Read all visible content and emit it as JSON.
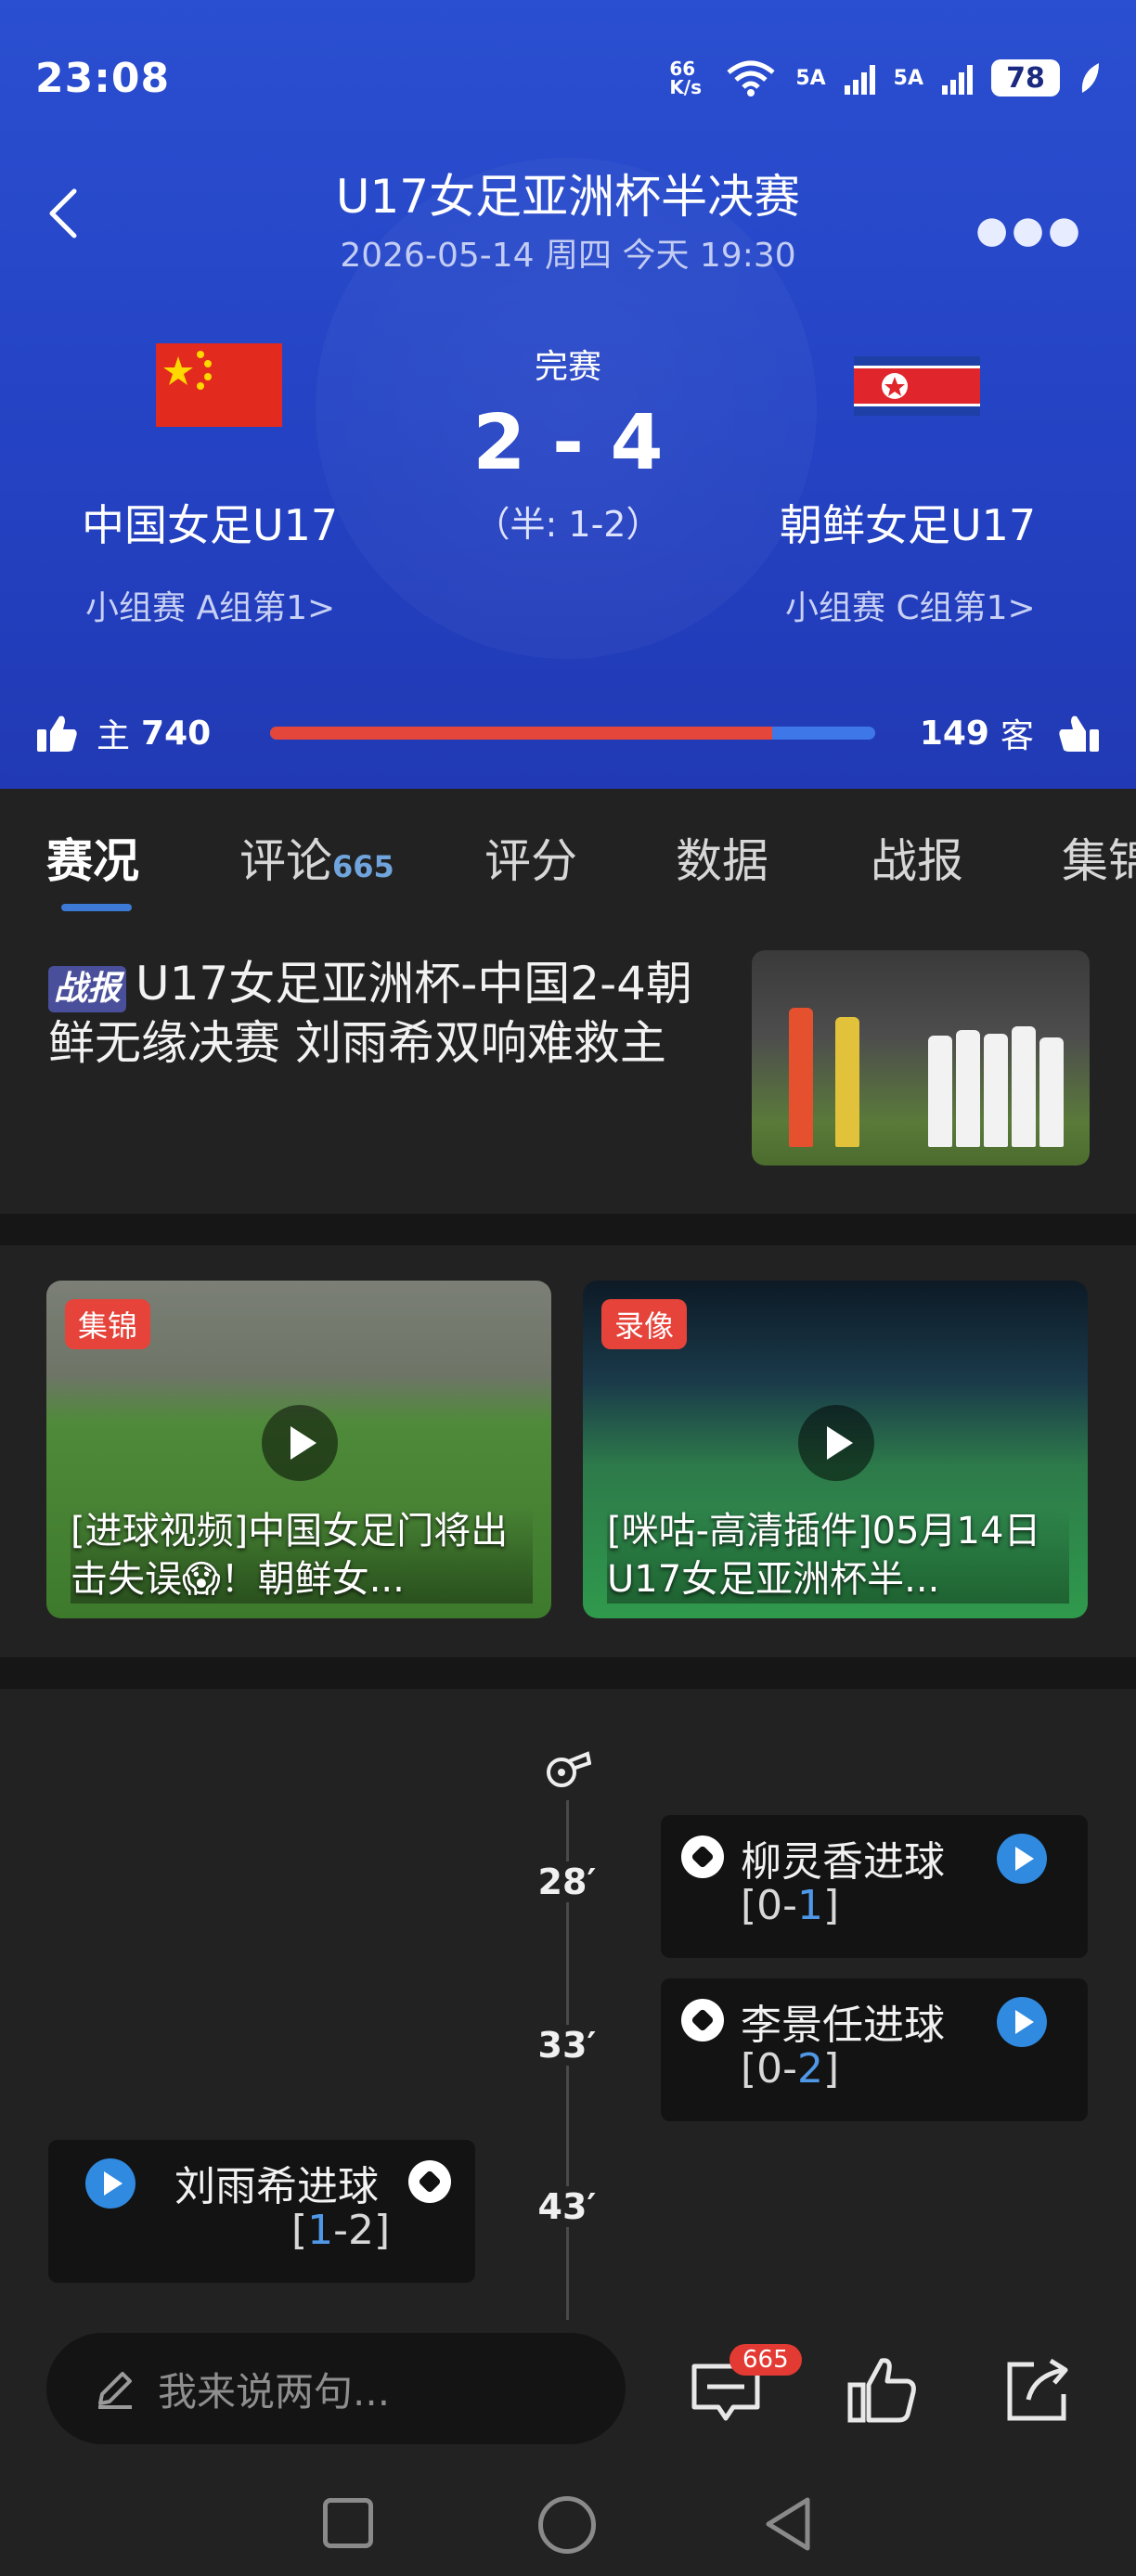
{
  "status_bar": {
    "time": "23:08",
    "net_speed": "66 K/s",
    "signal_1": "5A",
    "signal_2": "5A",
    "battery": "78"
  },
  "match": {
    "title": "U17女足亚洲杯半决赛",
    "datetime": "2026-05-14 周四 今天 19:30",
    "state": "完赛",
    "score": "2 - 4",
    "halftime": "（半: 1-2）",
    "home": {
      "name": "中国女足U17",
      "rank": "小组赛 A组第1>"
    },
    "away": {
      "name": "朝鲜女足U17",
      "rank": "小组赛 C组第1>"
    }
  },
  "votes": {
    "home_label": "主",
    "home_count": "740",
    "away_label": "客",
    "away_count": "149",
    "home_share": 0.83
  },
  "tabs": [
    {
      "label": "赛况"
    },
    {
      "label": "评论",
      "count": "665"
    },
    {
      "label": "评分"
    },
    {
      "label": "数据"
    },
    {
      "label": "战报"
    },
    {
      "label": "集锦"
    }
  ],
  "news": {
    "tag": "战报",
    "headline": "U17女足亚洲杯-中国2-4朝鲜无缘决赛 刘雨希双响难救主"
  },
  "videos": [
    {
      "badge": "集锦",
      "title": "[进球视频]中国女足门将出击失误😱！朝鲜女..."
    },
    {
      "badge": "录像",
      "title": "[咪咕-高清插件]05月14日  U17女足亚洲杯半..."
    }
  ],
  "timeline": [
    {
      "minute": "28′",
      "side": "away",
      "text": "柳灵香进球",
      "score_prefix": "[0-",
      "score_hl": "1",
      "score_suffix": "]"
    },
    {
      "minute": "33′",
      "side": "away",
      "text": "李景任进球",
      "score_prefix": "[0-",
      "score_hl": "2",
      "score_suffix": "]"
    },
    {
      "minute": "43′",
      "side": "home",
      "text": "刘雨希进球",
      "score_prefix": "[",
      "score_hl": "1",
      "score_suffix": "-2]"
    }
  ],
  "bottom_bar": {
    "input_placeholder": "我来说两句...",
    "comment_badge": "665"
  }
}
